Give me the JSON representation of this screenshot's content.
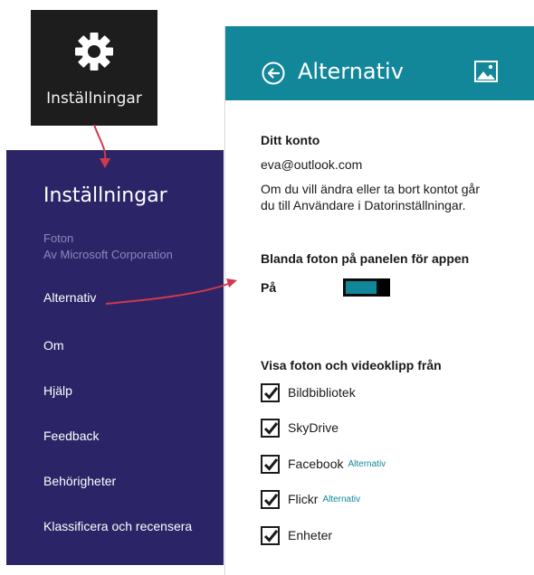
{
  "charm": {
    "label": "Inställningar",
    "icon": "gear-icon"
  },
  "settings_pane": {
    "title": "Inställningar",
    "app_name": "Foton",
    "app_publisher": "Av Microsoft Corporation",
    "items": [
      {
        "label": "Alternativ"
      },
      {
        "label": "Om"
      },
      {
        "label": "Hjälp"
      },
      {
        "label": "Feedback"
      },
      {
        "label": "Behörigheter"
      },
      {
        "label": "Klassificera och recensera"
      }
    ],
    "background": "#2b2467"
  },
  "options_panel": {
    "title": "Alternativ",
    "header_color": "#12879a",
    "account_heading": "Ditt konto",
    "account_email": "eva@outlook.com",
    "account_info_line1": "Om du vill ändra eller ta bort kontot går",
    "account_info_line2": "du till Användare i Datorinställningar.",
    "shuffle_heading": "Blanda foton på panelen för appen",
    "toggle_label": "På",
    "toggle_on": true,
    "sources_heading": "Visa foton och videoklipp från",
    "sources": [
      {
        "label": "Bildbibliotek",
        "checked": true,
        "link": ""
      },
      {
        "label": "SkyDrive",
        "checked": true,
        "link": ""
      },
      {
        "label": "Facebook",
        "checked": true,
        "link": "Alternativ"
      },
      {
        "label": "Flickr",
        "checked": true,
        "link": "Alternativ"
      },
      {
        "label": "Enheter",
        "checked": true,
        "link": ""
      }
    ]
  },
  "annotation_color": "#d03a4e"
}
